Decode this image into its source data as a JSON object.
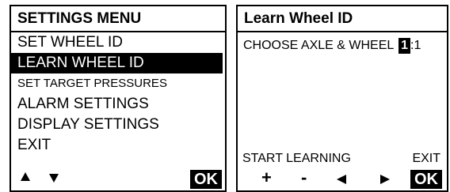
{
  "settings_menu": {
    "title": "SETTINGS MENU",
    "items": [
      {
        "label": "SET WHEEL ID",
        "selected": false
      },
      {
        "label": "LEARN WHEEL ID",
        "selected": true
      },
      {
        "label": "SET TARGET PRESSURES",
        "selected": false
      },
      {
        "label": "ALARM SETTINGS",
        "selected": false
      },
      {
        "label": "DISPLAY SETTINGS",
        "selected": false
      },
      {
        "label": "EXIT",
        "selected": false
      }
    ],
    "nav": {
      "up_icon": "triangle-up-icon",
      "down_icon": "triangle-down-icon",
      "ok_label": "OK"
    }
  },
  "learn_wheel": {
    "title": "Learn Wheel ID",
    "prompt": "CHOOSE AXLE & WHEEL",
    "axle_value": "1",
    "separator": ":",
    "wheel_value": "1",
    "start_label": "START LEARNING",
    "exit_label": "EXIT",
    "controls": {
      "plus": "+",
      "minus": "-",
      "left_icon": "triangle-left-icon",
      "right_icon": "triangle-right-icon",
      "ok_label": "OK"
    }
  }
}
